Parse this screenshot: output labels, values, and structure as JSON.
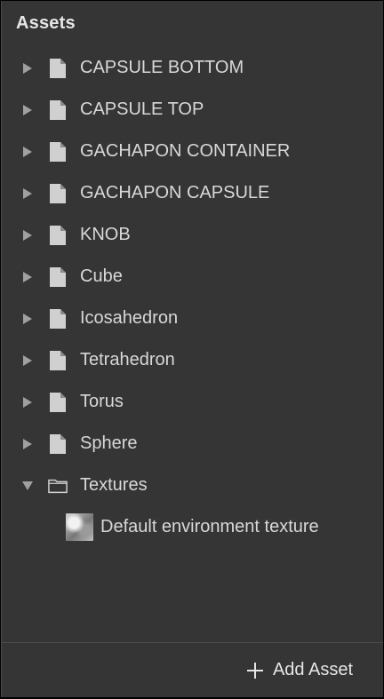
{
  "panel": {
    "title": "Assets"
  },
  "items": [
    {
      "label": "CAPSULE BOTTOM",
      "icon": "file-icon",
      "expanded": false
    },
    {
      "label": "CAPSULE TOP",
      "icon": "file-icon",
      "expanded": false
    },
    {
      "label": "GACHAPON CONTAINER",
      "icon": "file-icon",
      "expanded": false
    },
    {
      "label": "GACHAPON CAPSULE",
      "icon": "file-icon",
      "expanded": false
    },
    {
      "label": "KNOB",
      "icon": "file-icon",
      "expanded": false
    },
    {
      "label": "Cube",
      "icon": "file-icon",
      "expanded": false
    },
    {
      "label": "Icosahedron",
      "icon": "file-icon",
      "expanded": false
    },
    {
      "label": "Tetrahedron",
      "icon": "file-icon",
      "expanded": false
    },
    {
      "label": "Torus",
      "icon": "file-icon",
      "expanded": false
    },
    {
      "label": "Sphere",
      "icon": "file-icon",
      "expanded": false
    },
    {
      "label": "Textures",
      "icon": "folder-icon",
      "expanded": true
    }
  ],
  "texture_child": {
    "label": "Default environment texture",
    "icon": "texture-thumbnail"
  },
  "footer": {
    "add_asset_label": "Add Asset"
  },
  "colors": {
    "background": "#353535",
    "text": "#d8d8d8",
    "divider": "#4b4b4b"
  }
}
